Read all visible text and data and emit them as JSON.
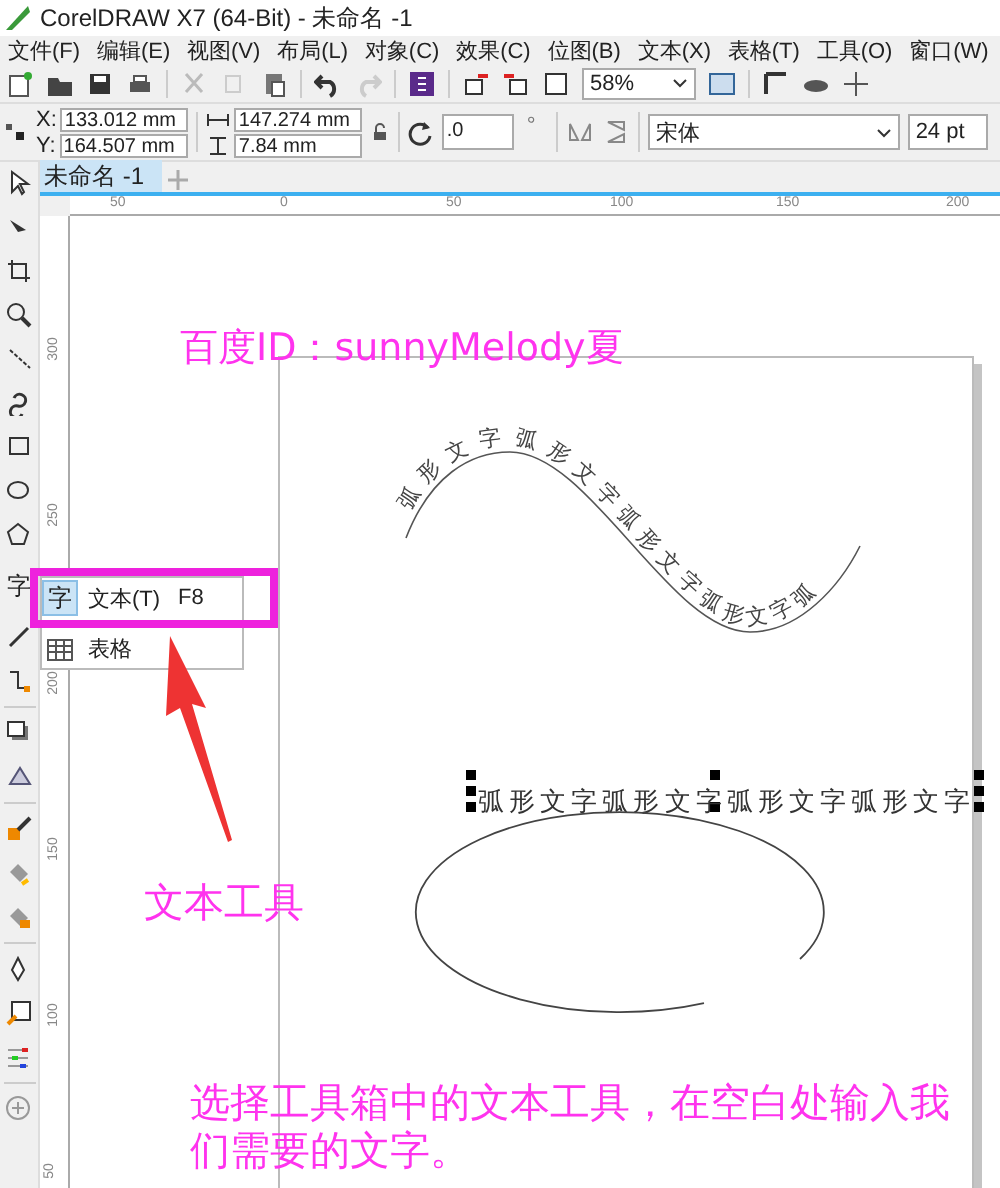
{
  "window": {
    "title": "CorelDRAW X7 (64-Bit) - 未命名 -1"
  },
  "menu": [
    "文件(F)",
    "编辑(E)",
    "视图(V)",
    "布局(L)",
    "对象(C)",
    "效果(C)",
    "位图(B)",
    "文本(X)",
    "表格(T)",
    "工具(O)",
    "窗口(W)"
  ],
  "toolbar": {
    "zoom": "58%"
  },
  "property_bar": {
    "x_label": "X:",
    "x": "133.012 mm",
    "y_label": "Y:",
    "y": "164.507 mm",
    "width": "147.274 mm",
    "height": "7.84 mm",
    "rotation": ".0",
    "degree_sign": "°",
    "font": "宋体",
    "font_size": "24 pt"
  },
  "document_tabs": [
    {
      "label": "未命名 -1",
      "selected": true
    }
  ],
  "rulers": {
    "horizontal": [
      "50",
      "0",
      "50",
      "100",
      "150",
      "200"
    ],
    "vertical": [
      "300",
      "250",
      "200",
      "150",
      "100",
      "50"
    ]
  },
  "toolbox": {
    "text_tool": "字"
  },
  "flyout": [
    {
      "icon": "字",
      "label": "文本(T)",
      "shortcut": "F8",
      "selected": true
    },
    {
      "kind": "table",
      "label": "表格",
      "selected": false
    }
  ],
  "canvas": {
    "curved_text": "弧形文字弧形文字弧形文字弧形文字弧",
    "selected_text": "弧形文字弧形文字弧形文字弧形文字"
  },
  "annotations": {
    "author": "百度ID：sunnyMelody夏",
    "tool_label": "文本工具",
    "instruction": "选择工具箱中的文本工具，在空白处输入我们需要的文字。"
  }
}
